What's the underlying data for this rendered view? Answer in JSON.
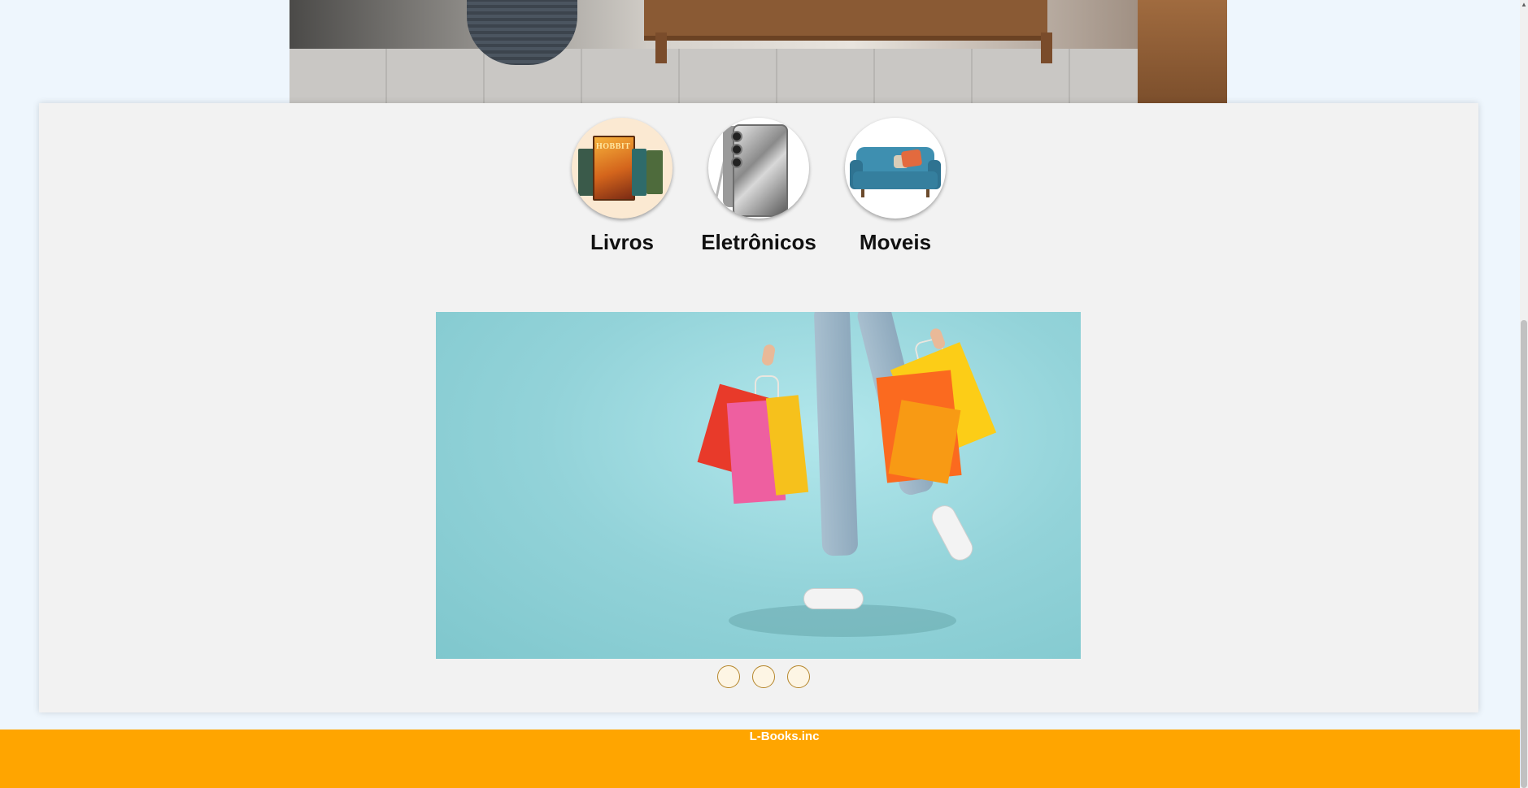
{
  "categories": [
    {
      "label": "Livros",
      "icon": "books-thumbnail"
    },
    {
      "label": "Eletrônicos",
      "icon": "smartphone-thumbnail"
    },
    {
      "label": "Moveis",
      "icon": "sofa-thumbnail"
    }
  ],
  "book_cover_title": "HOBBIT",
  "carousel": {
    "slide_count": 3,
    "active_index": 0
  },
  "footer": {
    "text": "L-Books.inc"
  },
  "colors": {
    "footer_bg": "#ffa500",
    "panel_bg": "#f2f2f2",
    "page_bg": "#eef6fd",
    "dot_border": "#b5862b"
  }
}
